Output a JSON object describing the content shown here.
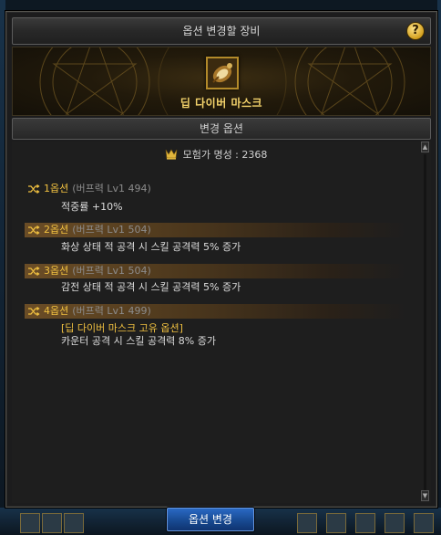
{
  "window": {
    "title": "옵션 변경할 장비",
    "help_label": "?"
  },
  "item": {
    "name": "딥 다이버 마스크",
    "icon": "mask-item-icon"
  },
  "section": {
    "title": "변경 옵션"
  },
  "fame": {
    "label": "모험가 명성 : 2368",
    "icon": "adventurer-fame-icon"
  },
  "options": [
    {
      "label": "1옵션",
      "meta": "(버프력 Lv1 494)",
      "desc": "적중률 +10%",
      "highlighted": false
    },
    {
      "label": "2옵션",
      "meta": "(버프력 Lv1 504)",
      "desc": "화상 상태 적 공격 시 스킬 공격력 5% 증가",
      "highlighted": true
    },
    {
      "label": "3옵션",
      "meta": "(버프력 Lv1 504)",
      "desc": "감전 상태 적 공격 시 스킬 공격력 5% 증가",
      "highlighted": true
    },
    {
      "label": "4옵션",
      "meta": "(버프력 Lv1 499)",
      "unique_note": "[딥 다이버 마스크 고유 옵션]",
      "desc": "카운터 공격 시 스킬 공격력 8% 증가",
      "highlighted": true
    }
  ],
  "scroll": {
    "up": "▲",
    "down": "▼"
  },
  "actions": {
    "change_label": "옵션 변경"
  },
  "colors": {
    "accent_gold": "#f0c040",
    "button_blue": "#1f5aae"
  }
}
